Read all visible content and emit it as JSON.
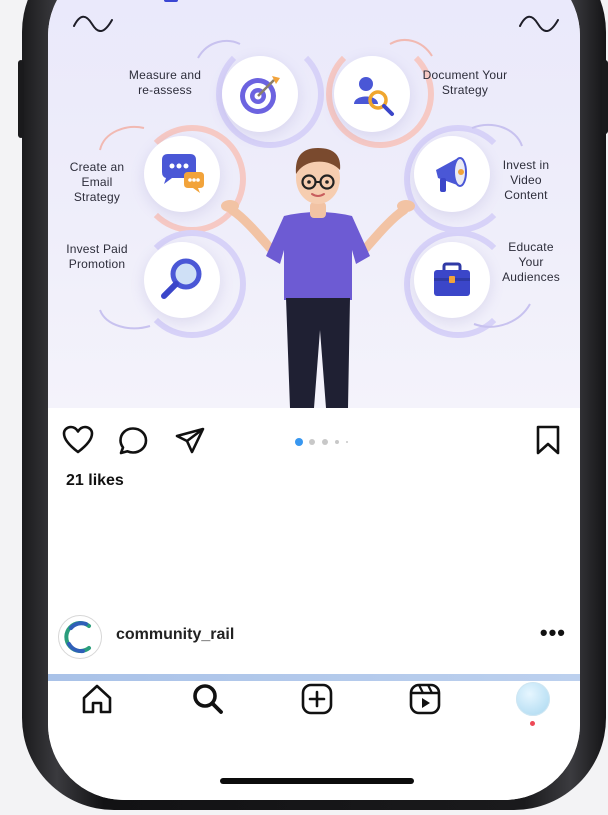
{
  "post": {
    "steps": {
      "measure": "Measure and re-assess",
      "document": "Document Your Strategy",
      "email": "Create an Email Strategy",
      "video": "Invest in Video Content",
      "paid": "Invest Paid Promotion",
      "educate": "Educate Your Audiences"
    },
    "carousel": {
      "total_dots": 5,
      "active_index": 0
    }
  },
  "likes": {
    "label": "21 likes"
  },
  "author": {
    "username": "community_rail"
  },
  "colors": {
    "accent": "#3897f0",
    "notification": "#ed4956",
    "figure_shirt": "#6d5bd3",
    "figure_pants": "#1f2033"
  },
  "icons": {
    "actions": [
      "heart-icon",
      "comment-icon",
      "share-icon",
      "bookmark-icon"
    ],
    "nav": [
      "home-icon",
      "search-icon",
      "create-icon",
      "reels-icon",
      "profile-avatar"
    ]
  }
}
